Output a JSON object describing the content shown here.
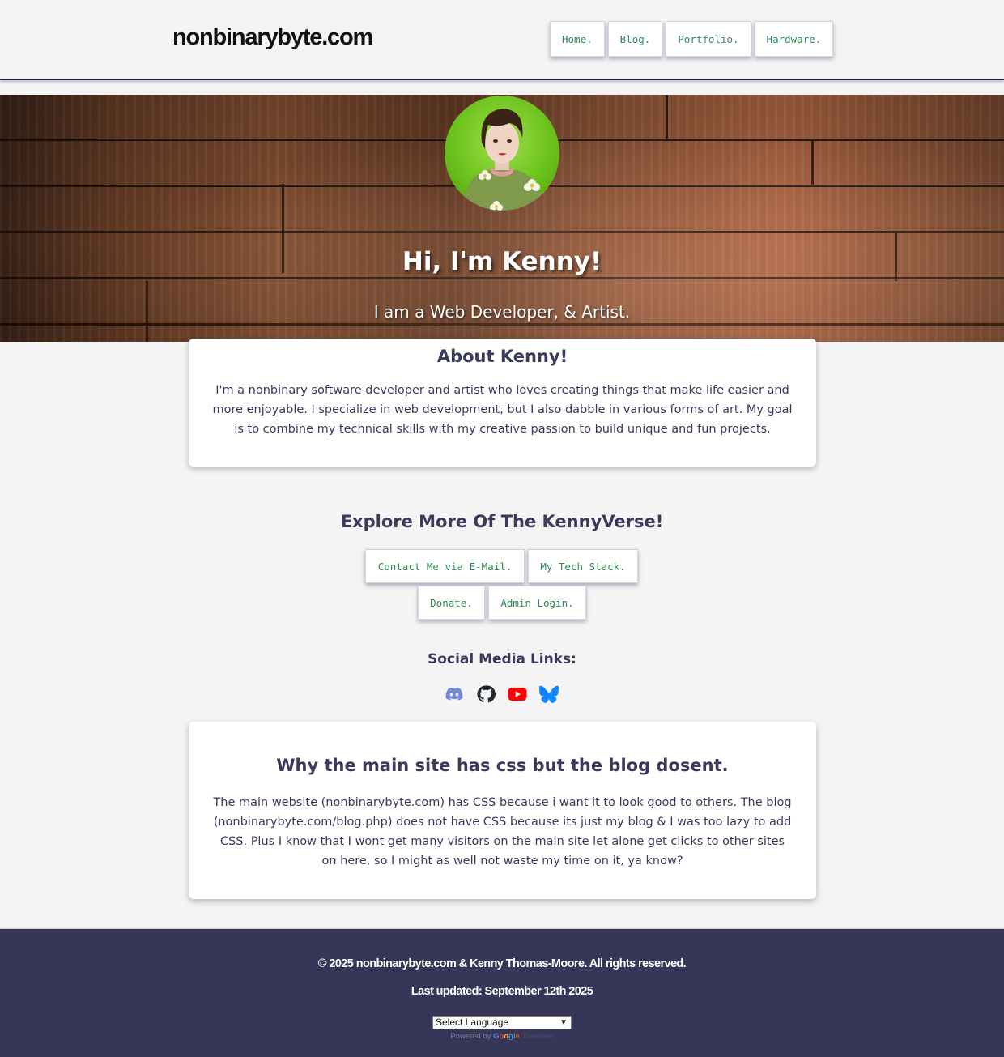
{
  "header": {
    "logo": "nonbinarybyte.com",
    "nav": [
      "Home.",
      "Blog.",
      "Portfolio.",
      "Hardware."
    ]
  },
  "hero": {
    "title": "Hi, I'm Kenny!",
    "subtitle": "I am a Web Developer, & Artist."
  },
  "about": {
    "title": "About Kenny!",
    "text": "I'm a nonbinary software developer and artist who loves creating things that make life easier and more enjoyable. I specialize in web development, but I also dabble in various forms of art. My goal is to combine my technical skills with my creative passion to build unique and fun projects."
  },
  "explore": {
    "title": "Explore More Of The KennyVerse!",
    "buttons": [
      "Contact Me via E-Mail.",
      "My Tech Stack.",
      "Donate.",
      "Admin Login."
    ]
  },
  "social": {
    "title": "Social Media Links:",
    "icons": [
      "discord-icon",
      "github-icon",
      "youtube-icon",
      "bluesky-icon"
    ]
  },
  "why": {
    "title": "Why the main site has css but the blog dosent.",
    "text": "The main website (nonbinarybyte.com) has CSS because i want it to look good to others. The blog (nonbinarybyte.com/blog.php) does not have CSS because its just my blog & I was too lazy to add CSS. Plus I know that I wont get many visitors on the main site let alone get clicks to other sites on here, so I might as well not waste my time on it, ya know?"
  },
  "footer": {
    "copyright": "© 2025 nonbinarybyte.com & Kenny Thomas-Moore. All rights reserved.",
    "updated": "Last updated: September 12th 2025",
    "language_select": "Select Language",
    "powered_by": "Powered by",
    "google": "Google",
    "translate": "Translate"
  },
  "colors": {
    "accent_text": "#2e8b57",
    "heading": "#3a3a5c",
    "footer_bg": "#363658"
  }
}
